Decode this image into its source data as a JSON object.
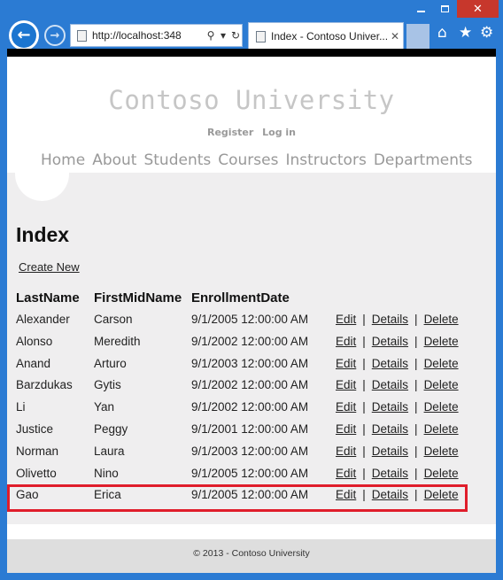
{
  "browser": {
    "address_url": "http://localhost:348",
    "tab_title": "Index - Contoso Univer...",
    "icons": {
      "back": "back-arrow-icon",
      "forward": "forward-arrow-icon",
      "search": "search-icon",
      "refresh": "refresh-icon",
      "close_tab": "close-icon",
      "home": "home-icon",
      "favorites": "star-icon",
      "tools": "gear-icon"
    },
    "colors": {
      "chrome": "#2b7bd3",
      "close_button": "#c7372c"
    }
  },
  "site": {
    "title": "Contoso University",
    "register_label": "Register",
    "login_label": "Log in",
    "menu": [
      "Home",
      "About",
      "Students",
      "Courses",
      "Instructors",
      "Departments"
    ]
  },
  "page": {
    "heading": "Index",
    "create_link": "Create New",
    "columns": [
      "LastName",
      "FirstMidName",
      "EnrollmentDate"
    ],
    "actions": {
      "edit": "Edit",
      "details": "Details",
      "delete": "Delete",
      "separator": "|"
    },
    "rows": [
      {
        "last": "Alexander",
        "first": "Carson",
        "date": "9/1/2005 12:00:00 AM"
      },
      {
        "last": "Alonso",
        "first": "Meredith",
        "date": "9/1/2002 12:00:00 AM"
      },
      {
        "last": "Anand",
        "first": "Arturo",
        "date": "9/1/2003 12:00:00 AM"
      },
      {
        "last": "Barzdukas",
        "first": "Gytis",
        "date": "9/1/2002 12:00:00 AM"
      },
      {
        "last": "Li",
        "first": "Yan",
        "date": "9/1/2002 12:00:00 AM"
      },
      {
        "last": "Justice",
        "first": "Peggy",
        "date": "9/1/2001 12:00:00 AM"
      },
      {
        "last": "Norman",
        "first": "Laura",
        "date": "9/1/2003 12:00:00 AM"
      },
      {
        "last": "Olivetto",
        "first": "Nino",
        "date": "9/1/2005 12:00:00 AM"
      },
      {
        "last": "Gao",
        "first": "Erica",
        "date": "9/1/2005 12:00:00 AM"
      }
    ],
    "highlight_color": "#e01d2b"
  },
  "footer": {
    "text": "© 2013 - Contoso University"
  }
}
